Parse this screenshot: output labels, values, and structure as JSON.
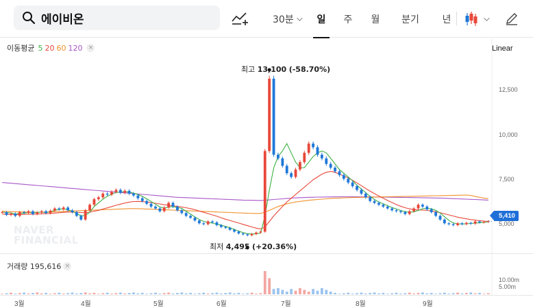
{
  "search": {
    "value": "에이비온",
    "icon": "search-icon"
  },
  "toolbar": {
    "compare_icon": "line-chart-plus-icon",
    "periods": {
      "p30": "30분",
      "day": "일",
      "week": "주",
      "month": "월",
      "quarter": "분기",
      "year": "년"
    },
    "selected_period": "일",
    "candle_icon": "candlestick-icon",
    "pencil_icon": "pencil-icon"
  },
  "legend": {
    "label": "이동평균",
    "ma5": "5",
    "ma20": "20",
    "ma60": "60",
    "ma120": "120",
    "colors": {
      "ma5": "#3cb043",
      "ma20": "#e8483a",
      "ma60": "#f0912c",
      "ma120": "#a855c8"
    }
  },
  "scale": "Linear",
  "y_axis": [
    "12,500",
    "10,000",
    "7,500",
    "5,000"
  ],
  "current_price": "5,410",
  "annotations": {
    "high_label": "최고",
    "high_value": "13,100",
    "high_pct": "(-58.70%)",
    "low_label": "최저",
    "low_value": "4,495",
    "low_pct": "(+20.36%)"
  },
  "watermark": {
    "line1": "NAVER",
    "line2": "FINANCIAL"
  },
  "volume": {
    "label": "거래량",
    "value": "195,616",
    "scale": [
      "10.00m",
      "5.00m"
    ]
  },
  "x_axis": [
    "3월",
    "4월",
    "5월",
    "6월",
    "7월",
    "8월",
    "9월"
  ],
  "colors": {
    "up": "#e8483a",
    "down": "#1f78d8"
  },
  "chart_data": {
    "type": "candlestick",
    "ylim": [
      4200,
      13800
    ],
    "months": [
      "3월",
      "4월",
      "5월",
      "6월",
      "7월",
      "8월",
      "9월"
    ],
    "high": 13100,
    "low": 4495,
    "last": 5410,
    "close_series": [
      5900,
      5750,
      5820,
      5700,
      5900,
      5860,
      5950,
      5800,
      5880,
      5950,
      5850,
      5980,
      6100,
      6050,
      6150,
      6000,
      5900,
      5700,
      5500,
      6000,
      6300,
      6600,
      6700,
      6900,
      6850,
      7000,
      7100,
      6950,
      7050,
      6900,
      6800,
      6650,
      6500,
      6350,
      6200,
      6100,
      5950,
      6150,
      6400,
      6200,
      6000,
      5850,
      5700,
      5600,
      5450,
      5300,
      5250,
      5400,
      5350,
      5200,
      5100,
      5050,
      4950,
      4850,
      4750,
      4700,
      4650,
      4720,
      4800,
      4850,
      9200,
      13100,
      9000,
      8800,
      8400,
      8000,
      7800,
      8200,
      8600,
      9100,
      9600,
      9400,
      9000,
      8800,
      8500,
      8300,
      8100,
      7900,
      7700,
      7500,
      7300,
      7100,
      6900,
      6700,
      6500,
      6400,
      6300,
      6200,
      6100,
      6000,
      5950,
      5900,
      5800,
      5950,
      6100,
      6300,
      6200,
      6050,
      5900,
      5700,
      5500,
      5300,
      5250,
      5200,
      5300,
      5250,
      5320,
      5280,
      5400,
      5350,
      5380,
      5410
    ],
    "ma_series": {
      "ma5": [
        5900,
        5880,
        5860,
        5800,
        5820,
        5850,
        5880,
        5860,
        5890,
        5900,
        5880,
        5920,
        6000,
        6050,
        6080,
        6020,
        5960,
        5820,
        5700,
        5720,
        5900,
        6200,
        6400,
        6600,
        6760,
        6860,
        6960,
        6990,
        7000,
        6980,
        6920,
        6850,
        6750,
        6620,
        6480,
        6330,
        6180,
        6120,
        6170,
        6200,
        6150,
        6100,
        5950,
        5800,
        5640,
        5500,
        5400,
        5350,
        5310,
        5250,
        5200,
        5130,
        5060,
        4970,
        4880,
        4800,
        4740,
        4720,
        4730,
        4760,
        5700,
        7100,
        8300,
        8900,
        9200,
        9600,
        9100,
        8600,
        8300,
        8300,
        8600,
        8900,
        9100,
        9200,
        9100,
        8800,
        8500,
        8200,
        8000,
        7800,
        7600,
        7350,
        7150,
        6950,
        6750,
        6580,
        6450,
        6350,
        6250,
        6150,
        6070,
        5990,
        5920,
        5900,
        5920,
        5990,
        6080,
        6100,
        6080,
        6000,
        5850,
        5650,
        5450,
        5320,
        5270,
        5260,
        5270,
        5290,
        5310,
        5330,
        5350,
        5380
      ],
      "ma20": [
        5800,
        5790,
        5780,
        5770,
        5770,
        5780,
        5790,
        5790,
        5800,
        5810,
        5820,
        5830,
        5850,
        5870,
        5890,
        5900,
        5900,
        5890,
        5880,
        5870,
        5900,
        5950,
        6000,
        6070,
        6130,
        6200,
        6270,
        6330,
        6390,
        6440,
        6470,
        6480,
        6470,
        6450,
        6420,
        6380,
        6340,
        6300,
        6270,
        6240,
        6210,
        6180,
        6140,
        6090,
        6030,
        5960,
        5890,
        5820,
        5750,
        5680,
        5600,
        5520,
        5450,
        5380,
        5310,
        5240,
        5170,
        5100,
        5040,
        4990,
        5100,
        5400,
        5700,
        5950,
        6200,
        6450,
        6650,
        6850,
        7050,
        7250,
        7450,
        7650,
        7800,
        7950,
        8050,
        8100,
        8050,
        7950,
        7850,
        7750,
        7620,
        7480,
        7330,
        7180,
        7030,
        6900,
        6770,
        6650,
        6530,
        6420,
        6310,
        6220,
        6140,
        6080,
        6040,
        6020,
        6010,
        5990,
        5960,
        5920,
        5870,
        5810,
        5750,
        5690,
        5630,
        5580,
        5540,
        5500,
        5470,
        5440,
        5420,
        5400
      ],
      "ma60": [
        5950,
        5940,
        5930,
        5920,
        5915,
        5910,
        5905,
        5900,
        5900,
        5900,
        5905,
        5910,
        5920,
        5930,
        5940,
        5950,
        5960,
        5970,
        5980,
        5990,
        6000,
        6010,
        6020,
        6030,
        6040,
        6050,
        6060,
        6070,
        6080,
        6090,
        6090,
        6085,
        6080,
        6070,
        6060,
        6050,
        6040,
        6030,
        6020,
        6010,
        6000,
        5990,
        5980,
        5970,
        5960,
        5950,
        5940,
        5930,
        5920,
        5910,
        5900,
        5890,
        5880,
        5870,
        5860,
        5850,
        5840,
        5835,
        5830,
        5830,
        5900,
        6000,
        6100,
        6200,
        6280,
        6350,
        6400,
        6450,
        6480,
        6510,
        6540,
        6560,
        6580,
        6600,
        6620,
        6640,
        6650,
        6660,
        6670,
        6680,
        6690,
        6695,
        6700,
        6705,
        6710,
        6715,
        6720,
        6725,
        6730,
        6735,
        6740,
        6745,
        6750,
        6755,
        6760,
        6765,
        6770,
        6775,
        6780,
        6785,
        6790,
        6795,
        6800,
        6805,
        6810,
        6815,
        6820,
        6800,
        6750,
        6700,
        6660,
        6630
      ],
      "ma120": [
        7500,
        7480,
        7460,
        7440,
        7420,
        7400,
        7380,
        7360,
        7340,
        7320,
        7300,
        7280,
        7260,
        7240,
        7220,
        7200,
        7180,
        7160,
        7140,
        7120,
        7100,
        7080,
        7060,
        7040,
        7020,
        7000,
        6980,
        6960,
        6940,
        6920,
        6900,
        6880,
        6860,
        6840,
        6820,
        6800,
        6780,
        6760,
        6740,
        6720,
        6700,
        6690,
        6680,
        6670,
        6660,
        6650,
        6640,
        6630,
        6620,
        6610,
        6600,
        6590,
        6580,
        6570,
        6560,
        6550,
        6545,
        6540,
        6535,
        6530,
        6540,
        6560,
        6580,
        6600,
        6620,
        6640,
        6655,
        6670,
        6680,
        6690,
        6700,
        6705,
        6710,
        6715,
        6720,
        6722,
        6724,
        6726,
        6728,
        6730,
        6730,
        6730,
        6728,
        6726,
        6724,
        6720,
        6716,
        6712,
        6708,
        6704,
        6700,
        6696,
        6692,
        6688,
        6684,
        6680,
        6676,
        6672,
        6668,
        6664,
        6660,
        6650,
        6640,
        6630,
        6620,
        6610,
        6600,
        6590,
        6580,
        6570,
        6560,
        6550
      ]
    },
    "volume_peaks": [
      {
        "month": "7월",
        "value_m": 13
      },
      {
        "month": "7월",
        "value_m": 9
      }
    ]
  }
}
